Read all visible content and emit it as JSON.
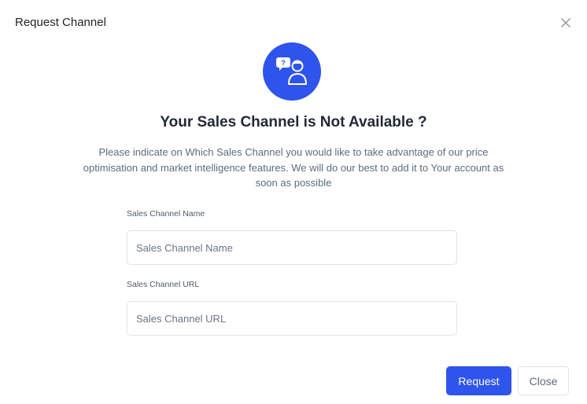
{
  "modal": {
    "title": "Request Channel",
    "close_icon": "close-icon",
    "hero_icon": "support-chat-user-icon",
    "heading": "Your Sales Channel is Not Available ?",
    "description": "Please indicate on Which Sales Channel you would like to take advantage of our price optimisation and market intelligence features. We will do our best to add it to Your account as soon as possible"
  },
  "form": {
    "name_label": "Sales Channel Name",
    "name_placeholder": "Sales Channel Name",
    "name_value": "",
    "url_label": "Sales Channel URL",
    "url_placeholder": "Sales Channel URL",
    "url_value": ""
  },
  "footer": {
    "request_label": "Request",
    "close_label": "Close"
  },
  "colors": {
    "accent": "#2f54eb",
    "heading": "#222a36",
    "muted": "#5f6b7a",
    "border": "#dfe3e8"
  }
}
